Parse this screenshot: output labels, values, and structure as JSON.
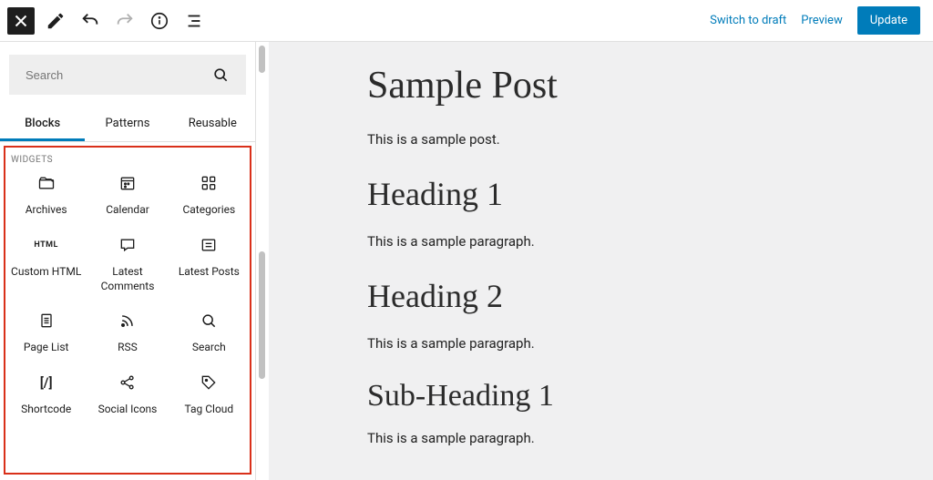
{
  "topbar": {
    "switch_to_draft": "Switch to draft",
    "preview": "Preview",
    "update": "Update"
  },
  "sidebar": {
    "search_placeholder": "Search",
    "tabs": {
      "blocks": "Blocks",
      "patterns": "Patterns",
      "reusable": "Reusable"
    },
    "panel_title": "WIDGETS",
    "widgets": {
      "archives": "Archives",
      "calendar": "Calendar",
      "categories": "Categories",
      "custom_html": "Custom HTML",
      "latest_comments": "Latest\nComments",
      "latest_posts": "Latest Posts",
      "page_list": "Page List",
      "rss": "RSS",
      "search": "Search",
      "shortcode": "Shortcode",
      "social_icons": "Social Icons",
      "tag_cloud": "Tag Cloud"
    }
  },
  "post": {
    "title": "Sample Post",
    "p1": "This is a sample post.",
    "h1": "Heading 1",
    "p2": "This is a sample paragraph.",
    "h2": "Heading 2",
    "p3": "This is a sample paragraph.",
    "sub1": "Sub-Heading 1",
    "p4": "This is a sample paragraph."
  }
}
